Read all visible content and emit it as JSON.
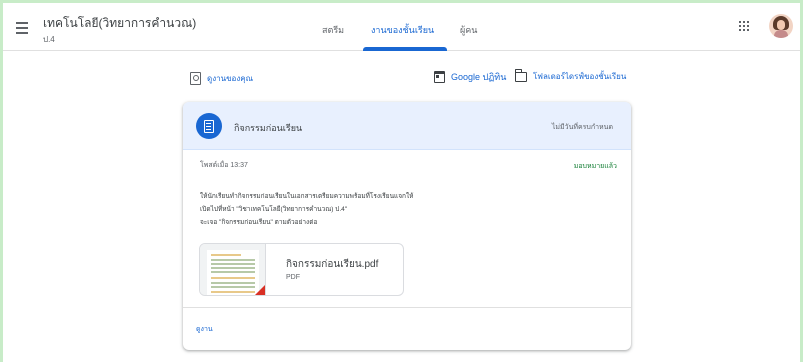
{
  "header": {
    "class_title": "เทคโนโลยี(วิทยาการคำนวณ)",
    "class_section": "ป.4",
    "tabs": [
      {
        "label": "สตรีม"
      },
      {
        "label": "งานของชั้นเรียน",
        "active": true
      },
      {
        "label": "ผู้คน"
      }
    ],
    "accent_color": "#1967d2"
  },
  "toolbar": {
    "your_work": "ดูงานของคุณ",
    "google_calendar": "Google ปฏิทิน",
    "drive_folder": "โฟลเดอร์ไดรฟ์ของชั้นเรียน"
  },
  "assignment": {
    "title": "กิจกรรมก่อนเรียน",
    "due": "ไม่มีวันที่ครบกำหนด",
    "posted": "โพสต์เมื่อ 13:37",
    "status": "มอบหมายแล้ว",
    "status_color": "#188038",
    "instructions": [
      "ให้นักเรียนทำกิจกรรมก่อนเรียนในเอกสารเตรียมความพร้อมที่โรงเรียนแจกให้",
      "เปิดไปที่หน้า \"วิชาเทคโนโลยี(วิทยาการคำนวณ) ป.4\"",
      "จะเจอ \"กิจกรรมก่อนเรียน\" ตามตัวอย่างต่อ"
    ],
    "attachment": {
      "name": "กิจกรรมก่อนเรียน.pdf",
      "type": "PDF"
    },
    "view_work": "ดูงาน"
  }
}
